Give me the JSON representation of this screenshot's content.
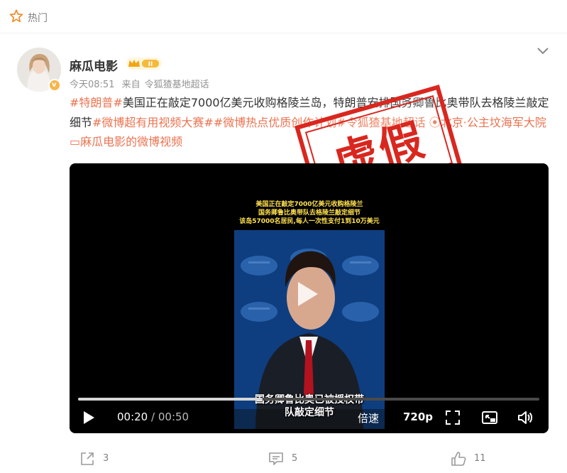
{
  "header": {
    "section_label": "热门"
  },
  "post": {
    "author": "麻瓜电影",
    "badge_level": "II",
    "time": "今天08:51",
    "source_prefix": "来自",
    "source": "令狐猹基地超话",
    "text_segments": [
      {
        "text": "#特朗普#",
        "kind": "tag"
      },
      {
        "text": "美国正在敲定7000亿美元收购格陵兰岛，特朗普安排国务卿鲁比奥带队去格陵兰敲定细节",
        "kind": "plain"
      },
      {
        "text": "#微博超有用视频大赛#",
        "kind": "tag"
      },
      {
        "text": "#微博热点优质创作计划#",
        "kind": "tag"
      },
      {
        "text": "令狐猹基地超话",
        "kind": "tag"
      },
      {
        "text": " ⦿北京·公主坟海军大院",
        "kind": "loc"
      },
      {
        "text": " ▭麻瓜电影的微博视频",
        "kind": "loc"
      }
    ],
    "stamp_text": "虚假"
  },
  "video": {
    "caption_top": [
      "美国正在敲定7000亿美元收购格陵兰",
      "国务卿鲁比奥带队去格陵兰敲定细节",
      "该岛57000名居民,每人一次性支付1到10万美元"
    ],
    "caption_bottom": [
      "国务卿鲁比奥已被授权带",
      "队敲定细节"
    ],
    "current_time": "00:20",
    "separator": "/",
    "total_time": "00:50",
    "progress": 0.4,
    "speed_label": "倍速",
    "quality_label": "720p"
  },
  "actions": {
    "share_count": "3",
    "comment_count": "5",
    "like_count": "11"
  },
  "colors": {
    "accent": "#eb7350",
    "stamp": "#d9271f",
    "video_bg": "#000000"
  }
}
